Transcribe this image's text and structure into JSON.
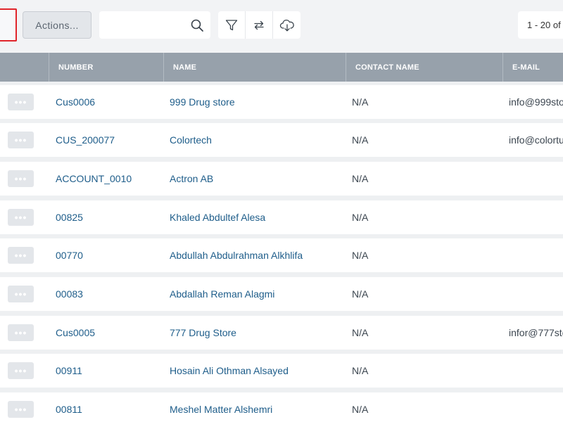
{
  "toolbar": {
    "dropdown_caret": "▾",
    "actions_label": "Actions...",
    "search_value": "",
    "pager_text": "1 - 20 of"
  },
  "table": {
    "headers": [
      "",
      "NUMBER",
      "NAME",
      "CONTACT NAME",
      "E-MAIL"
    ],
    "row_menu_label": "•••",
    "rows": [
      {
        "number": "Cus0006",
        "name": "999 Drug store",
        "contact": "N/A",
        "email": "info@999sto"
      },
      {
        "number": "CUS_200077",
        "name": "Colortech",
        "contact": "N/A",
        "email": "info@colortu"
      },
      {
        "number": "ACCOUNT_0010",
        "name": "Actron AB",
        "contact": "N/A",
        "email": ""
      },
      {
        "number": "00825",
        "name": "Khaled Abdultef Alesa",
        "contact": "N/A",
        "email": ""
      },
      {
        "number": "00770",
        "name": "Abdullah Abdulrahman Alkhlifa",
        "contact": "N/A",
        "email": ""
      },
      {
        "number": "00083",
        "name": "Abdallah Reman Alagmi",
        "contact": "N/A",
        "email": ""
      },
      {
        "number": "Cus0005",
        "name": "777 Drug Store",
        "contact": "N/A",
        "email": "infor@777sto"
      },
      {
        "number": "00911",
        "name": "Hosain Ali Othman Alsayed",
        "contact": "N/A",
        "email": ""
      },
      {
        "number": "00811",
        "name": "Meshel Matter Alshemri",
        "contact": "N/A",
        "email": ""
      }
    ]
  },
  "icons": {
    "search": "search-icon",
    "filter": "filter-icon",
    "sync": "sync-icon",
    "download": "cloud-download-icon"
  },
  "colors": {
    "link": "#1e5d8a",
    "header_bg": "#97a1ab",
    "highlight": "#e0242a"
  }
}
